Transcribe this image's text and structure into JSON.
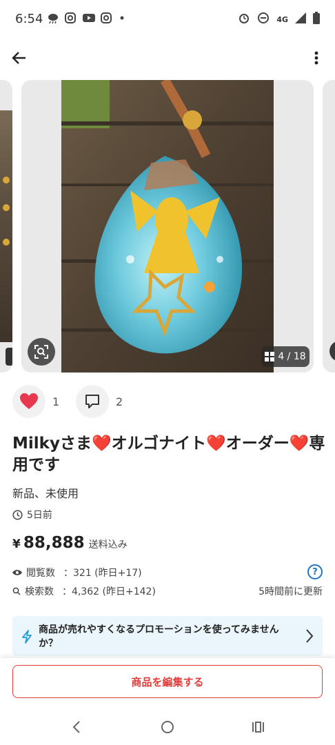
{
  "status_bar": {
    "time": "6:54",
    "network": "4G",
    "left_icons": [
      "cloud-rain-icon",
      "instagram-icon",
      "youtube-icon",
      "instagram-icon",
      "dot-icon"
    ],
    "right_icons": [
      "alarm-icon",
      "do-not-disturb-icon",
      "signal-icon",
      "battery-icon"
    ]
  },
  "gallery": {
    "counter": "4 / 18"
  },
  "actions": {
    "like_count": "1",
    "comment_count": "2"
  },
  "item": {
    "title": "Milkyさま❤️オルゴナイト❤️オーダー❤️専用です",
    "condition": "新品、未使用",
    "posted": "5日前",
    "price_symbol": "¥",
    "price": "88,888",
    "shipping": "送料込み"
  },
  "stats": {
    "views_label": "閲覧数",
    "views_value": "：321 (昨日+17)",
    "searches_label": "検索数",
    "searches_value": "：4,362 (昨日+142)",
    "updated": "5時間前に更新"
  },
  "promo": {
    "text": "商品が売れやすくなるプロモーションを使ってみませんか？"
  },
  "footer": {
    "edit_button": "商品を編集する"
  },
  "colors": {
    "accent_red": "#e33b3b",
    "heart": "#e8384f",
    "promo_bg": "#eaf6fb",
    "help_blue": "#1e74c9"
  }
}
